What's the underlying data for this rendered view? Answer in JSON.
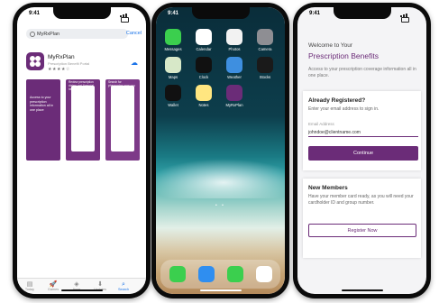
{
  "phone1": {
    "time": "9:41",
    "search_value": "MyRxPlan",
    "cancel_label": "Cancel",
    "app_name": "MyRxPlan",
    "app_subtitle": "Prescription Benefit Portal",
    "rating_stars": "★★★★☆",
    "screenshots": [
      {
        "caption": "Access to your prescription information all in one place"
      },
      {
        "caption": "Review prescription claims and financial history"
      },
      {
        "caption": "Search for pharmacies near you"
      }
    ],
    "tabs": [
      {
        "label": "Today",
        "icon": "today-icon",
        "glyph": "▤"
      },
      {
        "label": "Games",
        "icon": "games-icon",
        "glyph": "🚀"
      },
      {
        "label": "Apps",
        "icon": "apps-icon",
        "glyph": "◈"
      },
      {
        "label": "Updates",
        "icon": "updates-icon",
        "glyph": "⬇"
      },
      {
        "label": "Search",
        "icon": "search-icon",
        "glyph": "⌕"
      }
    ],
    "accent_color": "#1a73e8",
    "brand_color": "#6b2c78"
  },
  "phone2": {
    "time": "9:41",
    "apps": [
      {
        "label": "Messages",
        "color": "#3bcf4e",
        "icon": "messages-icon"
      },
      {
        "label": "Calendar",
        "color": "#ffffff",
        "icon": "calendar-icon"
      },
      {
        "label": "Photos",
        "color": "#f2f2f2",
        "icon": "photos-icon"
      },
      {
        "label": "Camera",
        "color": "#8e8e93",
        "icon": "camera-icon"
      },
      {
        "label": "Maps",
        "color": "#d7e8c8",
        "icon": "maps-icon"
      },
      {
        "label": "Clock",
        "color": "#111111",
        "icon": "clock-icon"
      },
      {
        "label": "Weather",
        "color": "#3e8fe0",
        "icon": "weather-icon"
      },
      {
        "label": "Stocks",
        "color": "#1a1a1a",
        "icon": "stocks-icon"
      },
      {
        "label": "Wallet",
        "color": "#111111",
        "icon": "wallet-icon"
      },
      {
        "label": "Notes",
        "color": "#ffe680",
        "icon": "notes-icon"
      },
      {
        "label": "MyRxPlan",
        "color": "#6b2c78",
        "icon": "myrxplan-icon"
      }
    ],
    "dock": [
      {
        "label": "Phone",
        "color": "#3bcf4e",
        "icon": "phone-icon"
      },
      {
        "label": "Safari",
        "color": "#2f8ef0",
        "icon": "safari-icon"
      },
      {
        "label": "Messages",
        "color": "#3bcf4e",
        "icon": "messages-icon"
      },
      {
        "label": "Music",
        "color": "#ffffff",
        "icon": "music-icon"
      }
    ]
  },
  "phone3": {
    "time": "9:41",
    "welcome": "Welcome to Your",
    "title": "Prescription Benefits",
    "intro": "Access to your prescription coverage information all in one place.",
    "registered_heading": "Already Registered?",
    "registered_sub": "Enter your email address to sign in.",
    "email_label": "Email Address",
    "email_value": "johndoe@clientname.com",
    "continue_label": "Continue",
    "new_heading": "New Members",
    "new_sub": "Have your member card ready, as you will need your cardholder ID and group number.",
    "register_label": "Register Now",
    "brand_color": "#6b2c78"
  }
}
